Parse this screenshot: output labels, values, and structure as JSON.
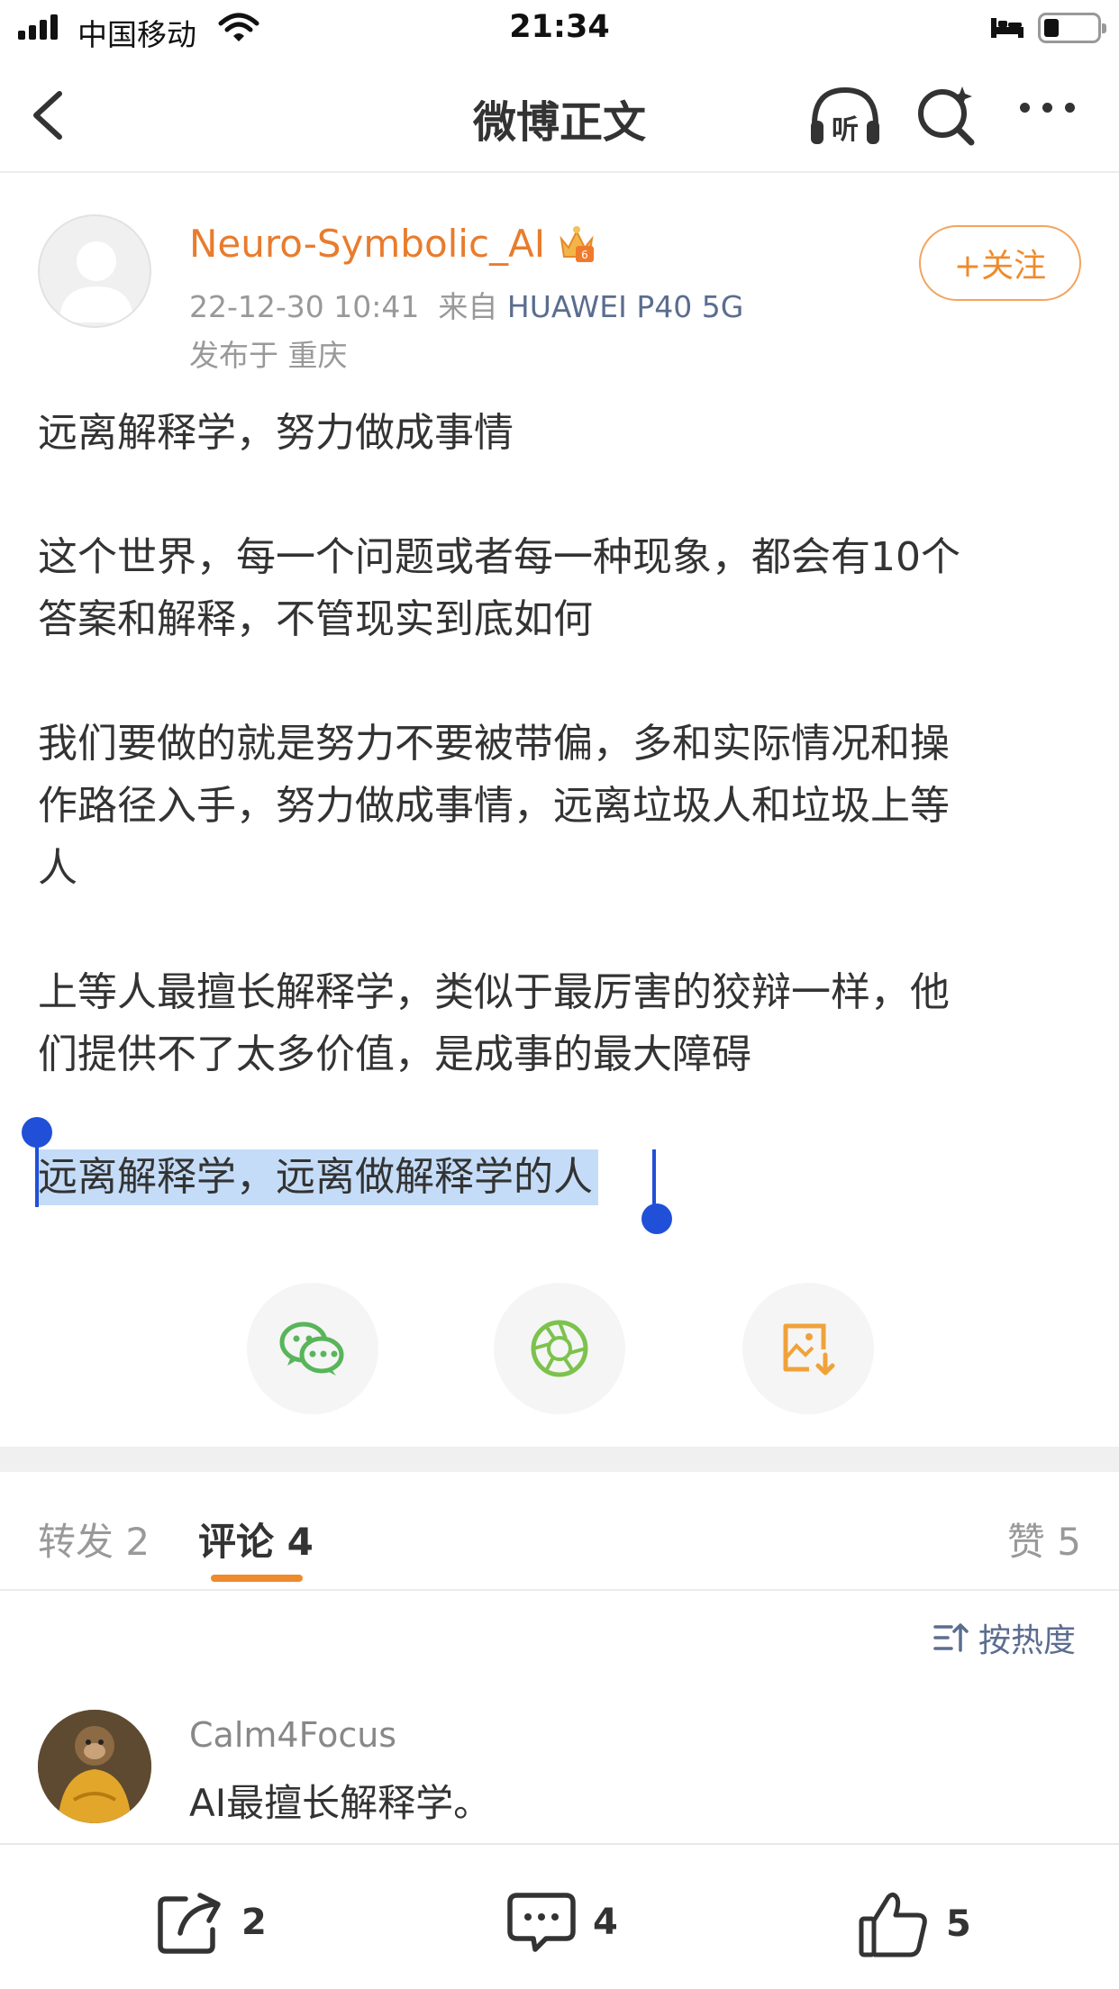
{
  "status_bar": {
    "carrier": "中国移动",
    "time": "21:34"
  },
  "nav": {
    "title": "微博正文",
    "listen_label": "听"
  },
  "post": {
    "author": "Neuro-Symbolic_AI",
    "timestamp": "22-12-30 10:41",
    "source_prefix": "来自",
    "device": "HUAWEI P40 5G",
    "location": "发布于 重庆",
    "follow_label": "+关注",
    "paragraphs": [
      "远离解释学，努力做成事情",
      "这个世界，每一个问题或者每一种现象，都会有10个\n答案和解释，不管现实到底如何",
      "我们要做的就是努力不要被带偏，多和实际情况和操\n作路径入手，努力做成事情，远离垃圾人和垃圾上等\n人",
      "上等人最擅长解释学，类似于最厉害的狡辩一样，他\n们提供不了太多价值，是成事的最大障碍"
    ],
    "selected_paragraph": "远离解释学，远离做解释学的人"
  },
  "tabs": {
    "forward": "转发 2",
    "comments": "评论 4",
    "likes": "赞 5"
  },
  "sort_label": "按热度",
  "comment": {
    "user": "Calm4Focus",
    "text": "AI最擅长解释学。"
  },
  "actions": {
    "repost_count": "2",
    "comment_count": "4",
    "like_count": "5"
  },
  "colors": {
    "accent": "#ef8a2c",
    "link_blue": "#5b6d8f",
    "selection": "#c4dcf7",
    "handle": "#2050d8"
  }
}
